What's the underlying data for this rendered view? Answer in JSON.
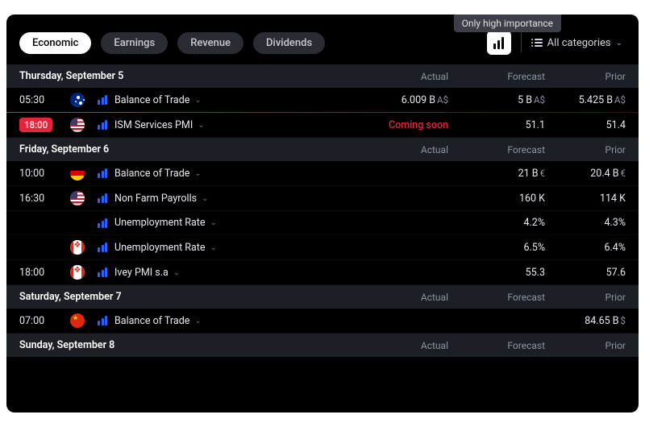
{
  "tooltip": "Only high importance",
  "tabs": [
    "Economic",
    "Earnings",
    "Revenue",
    "Dividends"
  ],
  "activeTab": 0,
  "categoriesLabel": "All categories",
  "columns": {
    "actual": "Actual",
    "forecast": "Forecast",
    "prior": "Prior"
  },
  "sections": [
    {
      "date": "Thursday, September 5",
      "rows": [
        {
          "time": "05:30",
          "flag": "au",
          "event": "Balance of Trade",
          "actual": "6.009 B",
          "actualUnit": "A$",
          "forecast": "5 B",
          "forecastUnit": "A$",
          "prior": "5.425 B",
          "priorUnit": "A$"
        },
        {
          "time": "18:00",
          "timeBadge": true,
          "flag": "us",
          "event": "ISM Services PMI",
          "actual": "Coming soon",
          "actualComing": true,
          "forecast": "51.1",
          "prior": "51.4",
          "highlight": true
        }
      ]
    },
    {
      "date": "Friday, September 6",
      "rows": [
        {
          "time": "10:00",
          "flag": "de",
          "event": "Balance of Trade",
          "forecast": "21 B",
          "forecastUnit": "€",
          "prior": "20.4 B",
          "priorUnit": "€"
        },
        {
          "time": "16:30",
          "flag": "us",
          "event": "Non Farm Payrolls",
          "forecast": "160 K",
          "prior": "114 K"
        },
        {
          "event": "Unemployment Rate",
          "forecast": "4.2%",
          "prior": "4.3%"
        },
        {
          "flag": "ca",
          "event": "Unemployment Rate",
          "forecast": "6.5%",
          "prior": "6.4%"
        },
        {
          "time": "18:00",
          "flag": "ca",
          "event": "Ivey PMI s.a",
          "forecast": "55.3",
          "prior": "57.6"
        }
      ]
    },
    {
      "date": "Saturday, September 7",
      "rows": [
        {
          "time": "07:00",
          "flag": "cn",
          "event": "Balance of Trade",
          "prior": "84.65 B",
          "priorUnit": "$"
        }
      ]
    },
    {
      "date": "Sunday, September 8",
      "rows": []
    }
  ]
}
